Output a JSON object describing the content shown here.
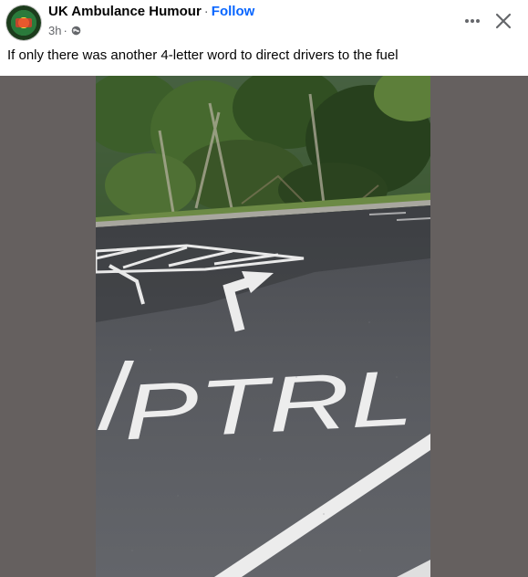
{
  "post": {
    "author": "UK Ambulance Humour",
    "separator": "·",
    "follow_label": "Follow",
    "timestamp": "3h",
    "meta_separator": "·",
    "audience_icon": "globe-icon",
    "caption": "If only there was another 4-letter word to direct drivers to the fuel"
  },
  "actions": {
    "more_icon": "more-horizontal-icon",
    "close_icon": "close-icon"
  },
  "photo": {
    "road_text": "PTRL"
  }
}
